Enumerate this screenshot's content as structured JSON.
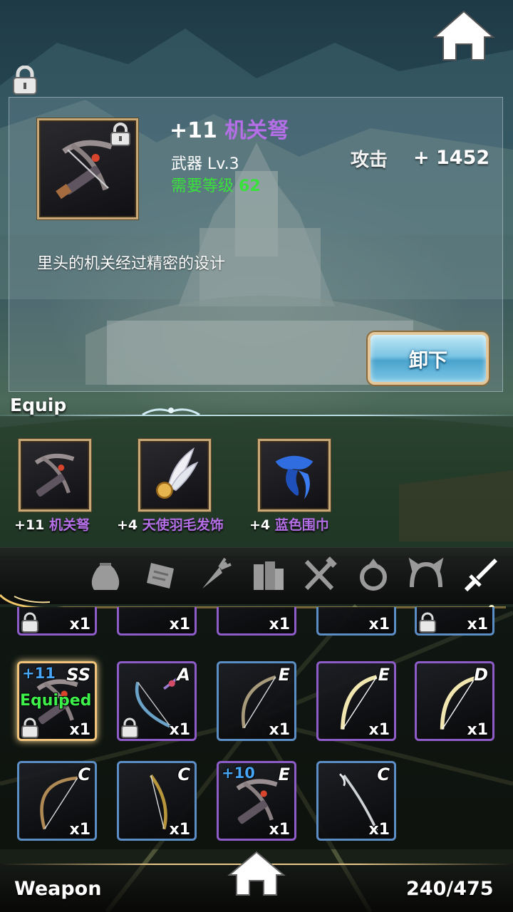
{
  "item_detail": {
    "enhance": "+11",
    "name": "机关弩",
    "type_label": "武器",
    "level": "Lv.3",
    "required_level_label": "需要等级",
    "required_level": "62",
    "stat_label": "攻击",
    "stat_value": "+ 1452",
    "description": "里头的机关经过精密的设计",
    "unequip_button": "卸下"
  },
  "equip_section": {
    "title": "Equip",
    "items": [
      {
        "enhance": "+11",
        "name": "机关弩",
        "icon": "crossbow-icon"
      },
      {
        "enhance": "+4",
        "name": "天使羽毛发饰",
        "icon": "angel-feather-hairpin-icon"
      },
      {
        "enhance": "+4",
        "name": "蓝色围巾",
        "icon": "blue-scarf-icon"
      }
    ]
  },
  "tabs": [
    "bag-icon",
    "scroll-icon",
    "carrot-icon",
    "books-icon",
    "fork-knife-icon",
    "ring-icon",
    "headband-icon",
    "sword-icon"
  ],
  "inventory": {
    "partial_row": [
      {
        "count": "x1",
        "locked": true
      },
      {
        "count": "x1",
        "locked": false
      },
      {
        "count": "x1",
        "locked": false
      },
      {
        "count": "x1",
        "locked": false
      },
      {
        "count": "x1",
        "locked": true
      }
    ],
    "row1": [
      {
        "enhance": "+11",
        "grade": "SS",
        "status": "Equiped",
        "count": "x1",
        "locked": true
      },
      {
        "enhance": "",
        "grade": "A",
        "status": "",
        "count": "x1",
        "locked": true
      },
      {
        "enhance": "",
        "grade": "E",
        "status": "",
        "count": "x1",
        "locked": false
      },
      {
        "enhance": "",
        "grade": "E",
        "status": "",
        "count": "x1",
        "locked": false
      },
      {
        "enhance": "",
        "grade": "D",
        "status": "",
        "count": "x1",
        "locked": false
      }
    ],
    "row2": [
      {
        "enhance": "",
        "grade": "C",
        "count": "x1"
      },
      {
        "enhance": "",
        "grade": "C",
        "count": "x1"
      },
      {
        "enhance": "+10",
        "grade": "E",
        "count": "x1"
      },
      {
        "enhance": "",
        "grade": "C",
        "count": "x1"
      }
    ]
  },
  "footer": {
    "category": "Weapon",
    "capacity": "240/475"
  },
  "colors": {
    "purple_name": "#b46ee6",
    "green_text": "#39e23b",
    "blue_name": "#4d8cf2",
    "enhance_blue": "#47a5f5"
  }
}
